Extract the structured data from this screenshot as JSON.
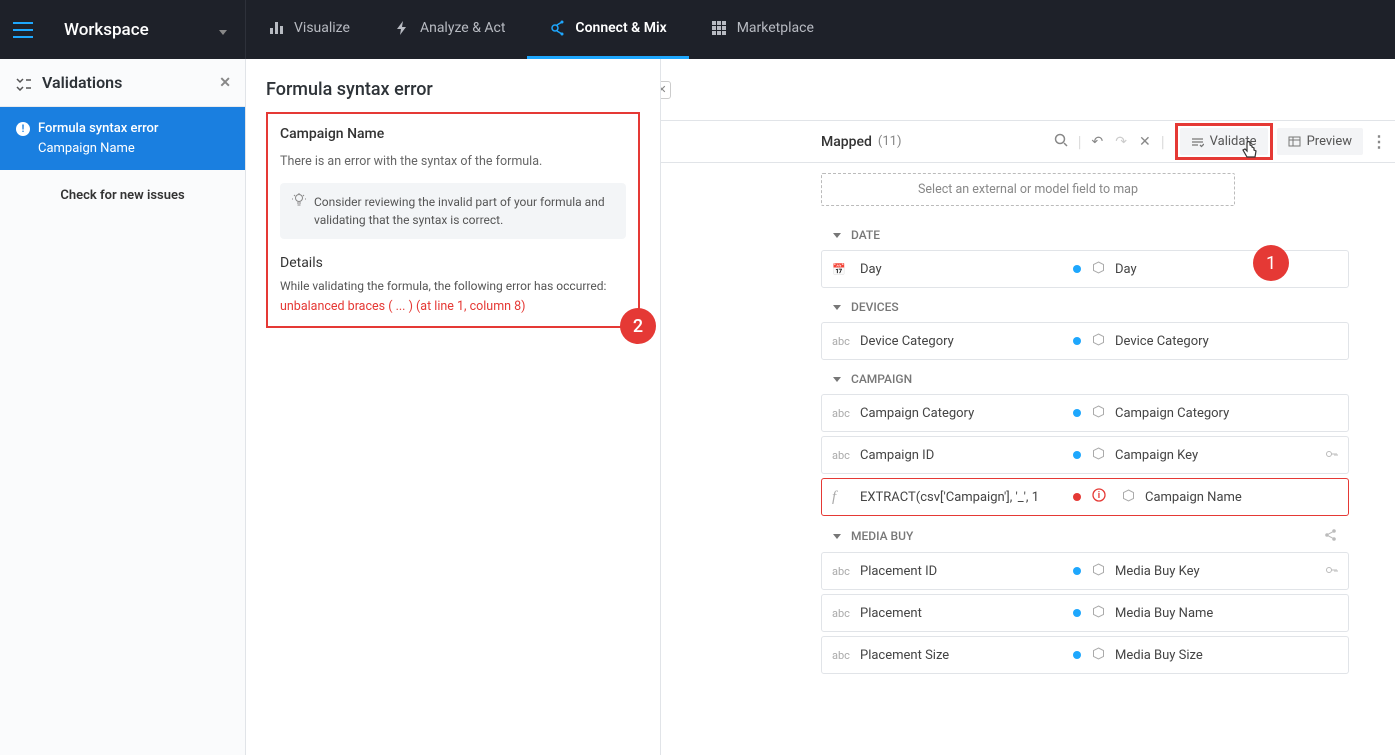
{
  "topbar": {
    "workspace": "Workspace",
    "tabs": [
      {
        "id": "visualize",
        "label": "Visualize"
      },
      {
        "id": "analyze",
        "label": "Analyze & Act"
      },
      {
        "id": "connect",
        "label": "Connect & Mix"
      },
      {
        "id": "marketplace",
        "label": "Marketplace"
      }
    ]
  },
  "sidebar": {
    "title": "Validations",
    "item_title": "Formula syntax error",
    "item_sub": "Campaign Name",
    "check": "Check for new issues"
  },
  "detail": {
    "heading": "Formula syntax error",
    "field": "Campaign Name",
    "desc": "There is an error with the syntax of the formula.",
    "hint": "Consider reviewing the invalid part of your formula and validating that the syntax is correct.",
    "details_title": "Details",
    "details_msg": "While validating the formula, the following error has occurred:",
    "error": "unbalanced braces ( ... ) (at line 1, column 8)"
  },
  "mapbar": {
    "title": "Mapped",
    "count": "(11)",
    "validate": "Validate",
    "preview": "Preview",
    "select_hint": "Select an external or model field to map"
  },
  "groups": {
    "date": "DATE",
    "devices": "DEVICES",
    "campaign": "CAMPAIGN",
    "mediabuy": "MEDIA BUY"
  },
  "fields": {
    "day_l": "Day",
    "day_r": "Day",
    "devcat_l": "Device Category",
    "devcat_r": "Device Category",
    "campcat_l": "Campaign Category",
    "campcat_r": "Campaign Category",
    "campid_l": "Campaign ID",
    "campid_r": "Campaign Key",
    "campname_l": "EXTRACT(csv['Campaign'], '_', 1",
    "campname_r": "Campaign Name",
    "plid_l": "Placement ID",
    "plid_r": "Media Buy Key",
    "pl_l": "Placement",
    "pl_r": "Media Buy Name",
    "plsize_l": "Placement Size",
    "plsize_r": "Media Buy Size"
  },
  "callouts": {
    "one": "1",
    "two": "2"
  }
}
